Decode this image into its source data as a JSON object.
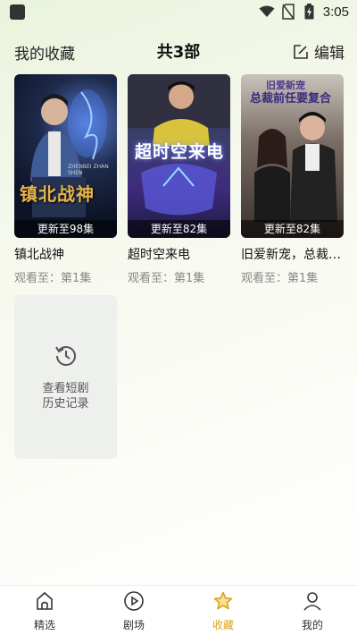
{
  "status_bar": {
    "time": "3:05"
  },
  "header": {
    "left_label": "我的收藏",
    "title": "共3部",
    "edit_label": "编辑"
  },
  "cards": [
    {
      "title": "镇北战神",
      "update": "更新至98集",
      "progress": "观看至：第1集",
      "poster_text": "镇北战神",
      "poster_sub": "ZHENBEI ZHAN SHEN"
    },
    {
      "title": "超时空来电",
      "update": "更新至82集",
      "progress": "观看至：第1集",
      "poster_text": "超时空来电"
    },
    {
      "title": "旧爱新宠，总裁前任复合",
      "update": "更新至82集",
      "progress": "观看至：第1集",
      "poster_text": "总裁前任要复合",
      "poster_sub": "旧爱新宠"
    }
  ],
  "history": {
    "label": "查看短剧历史记录"
  },
  "nav": [
    {
      "label": "精选",
      "icon": "home-icon"
    },
    {
      "label": "剧场",
      "icon": "play-icon"
    },
    {
      "label": "收藏",
      "icon": "star-icon",
      "active": true
    },
    {
      "label": "我的",
      "icon": "user-icon"
    }
  ],
  "colors": {
    "accent": "#d8a41c"
  }
}
